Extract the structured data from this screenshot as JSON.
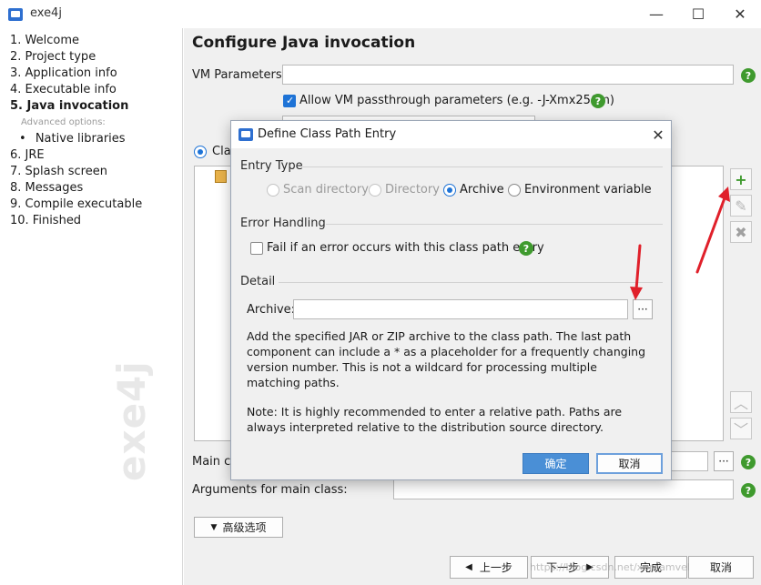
{
  "window": {
    "title": "exe4j",
    "minimize": "—",
    "maximize": "☐",
    "close": "✕"
  },
  "sidebar": {
    "steps": [
      "1. Welcome",
      "2. Project type",
      "3. Application info",
      "4. Executable info",
      "5. Java invocation",
      "Advanced options:",
      "Native libraries",
      "6. JRE",
      "7. Splash screen",
      "8. Messages",
      "9. Compile executable",
      "10. Finished"
    ],
    "bullet": "•",
    "watermark": "exe4j"
  },
  "main": {
    "title": "Configure Java invocation",
    "vm_params_label": "VM Parameters:",
    "vm_params_value": "",
    "allow_passthrough_label": "Allow VM passthrough parameters (e.g. -J-Xmx256m)",
    "allow_passthrough_checked": true,
    "class_path_radio_label": "Clas",
    "main_class_label": "Main cl",
    "arguments_label": "Arguments for main class:",
    "arguments_value": "",
    "advanced_button": "高级选项",
    "help_glyph": "?"
  },
  "side_buttons": {
    "add": "+",
    "edit": "✎",
    "remove": "✖",
    "up": "︿",
    "down": "﹀"
  },
  "footer": {
    "back": "上一步",
    "next": "下一步",
    "finish": "完成",
    "cancel": "取消",
    "url_overlay": "https://blog.csdn.net/xureamvel"
  },
  "dialog": {
    "title": "Define Class Path Entry",
    "close": "✕",
    "entry_type": {
      "title": "Entry Type",
      "options": [
        "Scan directory",
        "Directory",
        "Archive",
        "Environment variable"
      ],
      "selected": "Archive"
    },
    "error_handling": {
      "title": "Error Handling",
      "fail_label": "Fail if an error occurs with this class path entry",
      "fail_checked": false
    },
    "detail": {
      "title": "Detail",
      "archive_label": "Archive:",
      "archive_value": "",
      "browse": "···",
      "description": "Add the specified JAR or ZIP archive to the class path. The last path component can include a * as a placeholder for a frequently changing version number. This is not a wildcard for processing multiple matching paths.",
      "note": "Note: It is highly recommended to enter a relative path. Paths are always interpreted relative to the distribution source directory."
    },
    "ok": "确定",
    "cancel": "取消"
  },
  "colors": {
    "accent": "#1e73d6",
    "help_green": "#3f9a2e",
    "annotation_red": "#e0202a",
    "primary_button": "#4a8fd6"
  }
}
